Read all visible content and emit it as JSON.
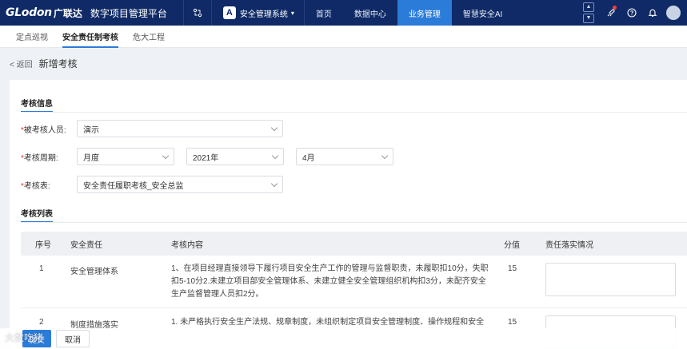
{
  "header": {
    "logo_en": "GLodon",
    "logo_cn": "广联达",
    "platform": "数字项目管理平台",
    "system_badge": "A",
    "system_name": "安全管理系统",
    "nav": [
      {
        "label": "首页",
        "active": false
      },
      {
        "label": "数据中心",
        "active": false
      },
      {
        "label": "业务管理",
        "active": true
      },
      {
        "label": "智慧安全AI",
        "active": false
      }
    ],
    "icons": [
      "scroll-up-icon",
      "scroll-down-icon",
      "rocket-icon",
      "help-icon",
      "bell-icon",
      "avatar"
    ]
  },
  "subtabs": [
    {
      "label": "定点巡视",
      "active": false
    },
    {
      "label": "安全责任制考核",
      "active": true
    },
    {
      "label": "危大工程",
      "active": false
    }
  ],
  "page": {
    "back": "< 返回",
    "title": "新增考核"
  },
  "form": {
    "section_title": "考核信息",
    "assessee_label": "被考核人员:",
    "assessee_value": "演示",
    "period_label": "考核周期:",
    "period_type": "月度",
    "period_year": "2021年",
    "period_month": "4月",
    "table_label": "考核表:",
    "table_value": "安全责任履职考核_安全总监",
    "required_mark": "*"
  },
  "list": {
    "section_title": "考核列表",
    "columns": [
      "序号",
      "安全责任",
      "考核内容",
      "分值",
      "责任落实情况"
    ],
    "rows": [
      {
        "no": "1",
        "duty": "安全管理体系",
        "content": "1、在项目经理直接领导下履行项目安全生产工作的管理与监督职责，未履职扣10分，失职扣5-10分2.未建立项目部安全管理体系、未建立健全安全管理组织机构扣3分，未配齐安全生产监督管理人员扣2分。",
        "score": "15"
      },
      {
        "no": "2",
        "duty": "制度措施落实",
        "content": "1. 未严格执行安全生产法规、规章制度，未组织制定项目安全管理制度、操作规程和安全",
        "score": "15"
      }
    ]
  },
  "footer": {
    "submit": "提交",
    "cancel": "取消",
    "watermark": "大数吃猪"
  },
  "colors": {
    "topbar": "#0f2a66",
    "accent": "#2b7bd8",
    "required": "#e0301e"
  }
}
